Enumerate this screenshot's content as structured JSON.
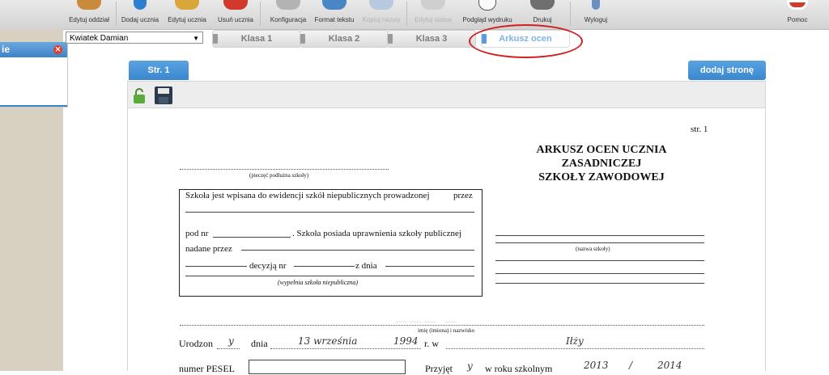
{
  "toolbar": {
    "items": [
      {
        "label": "Edytuj oddział",
        "disabled": false,
        "color": "#c98b3a"
      },
      {
        "label": "Dodaj ucznia",
        "disabled": false,
        "color": "#2f7fd0"
      },
      {
        "label": "Edytuj ucznia",
        "disabled": false,
        "color": "#d9a63a"
      },
      {
        "label": "Usuń ucznia",
        "disabled": false,
        "color": "#d0392b"
      },
      {
        "label": "Konfiguracja",
        "disabled": false,
        "color": "#9a9a9a"
      },
      {
        "label": "Format tekstu",
        "disabled": false,
        "color": "#4a86c5"
      },
      {
        "label": "Kopiuj nazwy",
        "disabled": true,
        "color": "#b7c9dc"
      },
      {
        "label": "Edytuj status",
        "disabled": true,
        "color": "#c4c4c4"
      },
      {
        "label": "Podgląd wydruku",
        "disabled": false,
        "color": "#555555"
      },
      {
        "label": "Drukuj",
        "disabled": false,
        "color": "#777777"
      },
      {
        "label": "Wyloguj",
        "disabled": false,
        "color": "#6b8fc2"
      },
      {
        "label": "Pomoc",
        "disabled": false,
        "color": "#d33a2a"
      }
    ]
  },
  "side_panel": {
    "title": "ie"
  },
  "student_select": {
    "value": "Kwiatek Damian"
  },
  "tabs": [
    "Klasa 1",
    "Klasa 2",
    "Klasa 3",
    "Arkusz ocen"
  ],
  "page_tabs": {
    "current": "Str. 1",
    "add": "dodaj stronę"
  },
  "document": {
    "page_no": "str. 1",
    "title_lines": [
      "ARKUSZ OCEN UCZNIA",
      "ZASADNICZEJ",
      "SZKOŁY ZAWODOWEJ"
    ],
    "stamp_label": "(pieczęć podłużna szkoły)",
    "box_line1": "Szkoła jest wpisana do ewidencji szkół niepublicznych prowadzonej",
    "box_przez": "przez",
    "box_pod_nr": "pod nr",
    "box_posiada": ". Szkoła posiada uprawnienia szkoły publicznej",
    "box_nadane": "nadane przez",
    "box_decyzja": "decyzją nr",
    "box_z_dnia": "z dnia",
    "box_note": "(wypełnia szkoła niepubliczna)",
    "school_name_label": "(nazwa szkoły)",
    "name_label": "imię (imiona) i nazwisko",
    "born_prefix": "Urodzon",
    "born_suffix": "y",
    "born_dnia": "dnia",
    "born_date": "13 września",
    "born_year": "1994",
    "born_rw": "r. w",
    "born_place": "Iłży",
    "pesel_label": "numer PESEL",
    "przyjet_prefix": "Przyjęt",
    "przyjet_suffix": "y",
    "school_year_label": "w roku szkolnym",
    "year_from": "2013",
    "year_sep": "/",
    "year_to": "2014"
  }
}
